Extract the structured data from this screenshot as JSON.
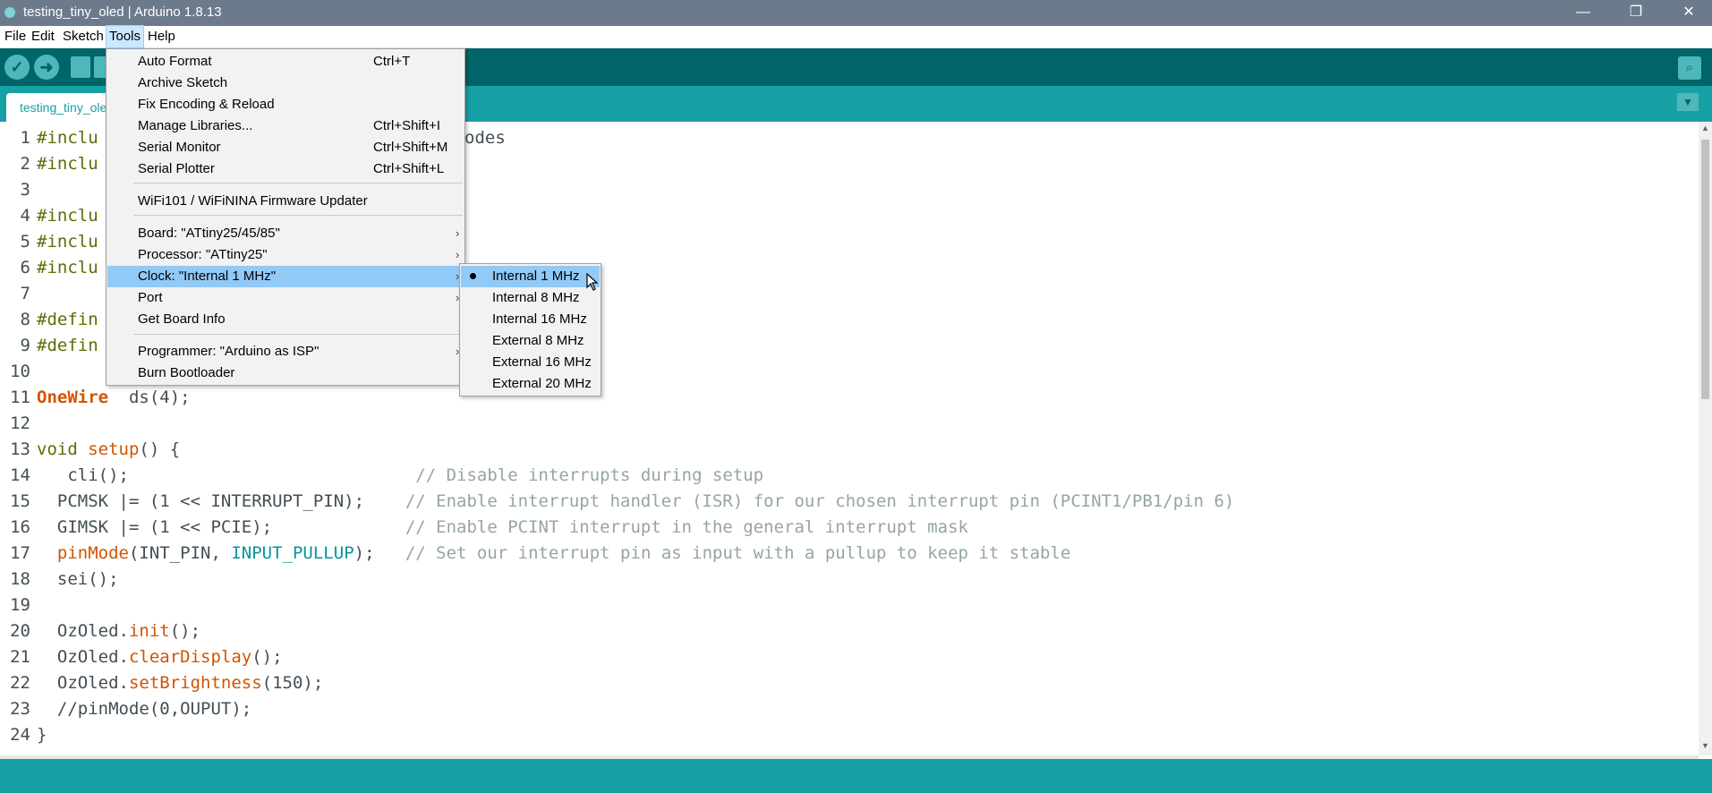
{
  "window": {
    "title": "testing_tiny_oled | Arduino 1.8.13",
    "minimize": "—",
    "restore": "❐",
    "close": "✕"
  },
  "menubar": [
    "File",
    "Edit",
    "Sketch",
    "Tools",
    "Help"
  ],
  "toolbar": {
    "verify_icon": "✓",
    "upload_icon": "➜",
    "new_icon": "new-file-icon",
    "serial_monitor_icon": "magnifier-icon"
  },
  "tab": {
    "label": "testing_tiny_oled",
    "menu_icon": "▼"
  },
  "tools_menu": {
    "items": [
      {
        "label": "Auto Format",
        "shortcut": "Ctrl+T"
      },
      {
        "label": "Archive Sketch",
        "shortcut": ""
      },
      {
        "label": "Fix Encoding & Reload",
        "shortcut": ""
      },
      {
        "label": "Manage Libraries...",
        "shortcut": "Ctrl+Shift+I"
      },
      {
        "label": "Serial Monitor",
        "shortcut": "Ctrl+Shift+M"
      },
      {
        "label": "Serial Plotter",
        "shortcut": "Ctrl+Shift+L"
      },
      {
        "label": "WiFi101 / WiFiNINA Firmware Updater",
        "shortcut": ""
      },
      {
        "label": "Board: \"ATtiny25/45/85\"",
        "shortcut": ""
      },
      {
        "label": "Processor: \"ATtiny25\"",
        "shortcut": ""
      },
      {
        "label": "Clock: \"Internal 1 MHz\"",
        "shortcut": ""
      },
      {
        "label": "Port",
        "shortcut": ""
      },
      {
        "label": "Get Board Info",
        "shortcut": ""
      },
      {
        "label": "Programmer: \"Arduino as ISP\"",
        "shortcut": ""
      },
      {
        "label": "Burn Bootloader",
        "shortcut": ""
      }
    ],
    "submenu_arrow": "›"
  },
  "clock_menu": {
    "items": [
      "Internal 1 MHz",
      "Internal 8 MHz",
      "Internal 16 MHz",
      "External 8 MHz",
      "External 16 MHz",
      "External 20 MHz"
    ],
    "selected": "Internal 1 MHz"
  },
  "editor": {
    "line_numbers": [
      "1",
      "2",
      "3",
      "4",
      "5",
      "6",
      "7",
      "8",
      "9",
      "10",
      "11",
      "12",
      "13",
      "14",
      "15",
      "16",
      "17",
      "18",
      "19",
      "20",
      "21",
      "22",
      "23",
      "24"
    ],
    "lines": {
      "l1_kw": "#inclu",
      "l1_rest": "odes",
      "l2_kw": "#inclu",
      "l4_kw": "#inclu",
      "l5_kw": "#inclu",
      "l6_kw": "#inclu",
      "l8_kw": "#defin",
      "l9_kw": "#defin",
      "l11_type": "OneWire",
      "l11_rest": "  ds(4);",
      "l13_kw": "void",
      "l13_fn": "setup",
      "l13_rest": "() {",
      "l14_code": "   cli();                            ",
      "l14_cmt": "// Disable interrupts during setup",
      "l15_code": "  PCMSK |= (1 << INTERRUPT_PIN);    ",
      "l15_cmt": "// Enable interrupt handler (ISR) for our chosen interrupt pin (PCINT1/PB1/pin 6)",
      "l16_code": "  GIMSK |= (1 << PCIE);             ",
      "l16_cmt": "// Enable PCINT interrupt in the general interrupt mask",
      "l17_fn": "pinMode",
      "l17_a": "(INT_PIN, ",
      "l17_const": "INPUT_PULLUP",
      "l17_b": ");   ",
      "l17_cmt": "// Set our interrupt pin as input with a pullup to keep it stable",
      "l18_code": "  sei();",
      "l20_obj": "  OzOled.",
      "l20_fn": "init",
      "l20_rest": "();",
      "l21_obj": "  OzOled.",
      "l21_fn": "clearDisplay",
      "l21_rest": "();",
      "l22_obj": "  OzOled.",
      "l22_fn": "setBrightness",
      "l22_rest": "(150);",
      "l23_code": "  //pinMode(0,OUPUT);",
      "l24_code": "}"
    }
  },
  "colors": {
    "toolbar": "#006468",
    "tabbar": "#17a1a5",
    "keyword": "#5e6d03",
    "function": "#d35400",
    "constant": "#00979c",
    "comment": "#95a5a6",
    "menu_highlight": "#91c9f7"
  }
}
